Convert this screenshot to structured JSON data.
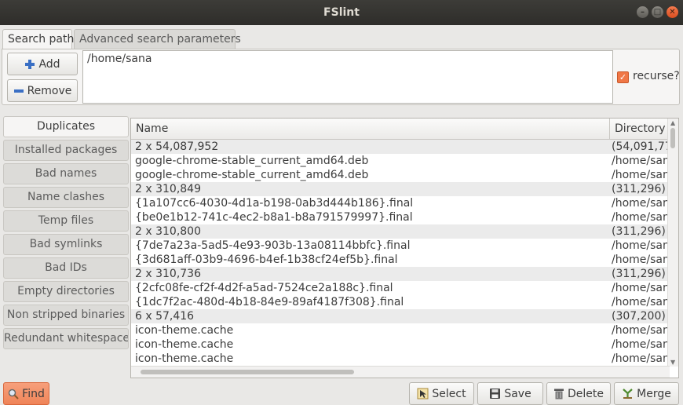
{
  "window": {
    "title": "FSlint"
  },
  "tabs": [
    {
      "label": "Search path"
    },
    {
      "label": "Advanced search parameters"
    }
  ],
  "path_panel": {
    "add_label": "Add",
    "remove_label": "Remove",
    "paths": [
      "/home/sana"
    ],
    "recurse_label": "recurse?",
    "recurse_checked": true
  },
  "sidebar": {
    "items": [
      {
        "label": "Duplicates"
      },
      {
        "label": "Installed packages"
      },
      {
        "label": "Bad names"
      },
      {
        "label": "Name clashes"
      },
      {
        "label": "Temp files"
      },
      {
        "label": "Bad symlinks"
      },
      {
        "label": "Bad IDs"
      },
      {
        "label": "Empty directories"
      },
      {
        "label": "Non stripped binaries"
      },
      {
        "label": "Redundant whitespace"
      }
    ]
  },
  "results": {
    "columns": [
      "Name",
      "Directory"
    ],
    "rows": [
      {
        "name": "2 x 54,087,952",
        "dir": "(54,091,77",
        "group": true
      },
      {
        "name": "google-chrome-stable_current_amd64.deb",
        "dir": "/home/san",
        "group": false
      },
      {
        "name": "google-chrome-stable_current_amd64.deb",
        "dir": "/home/san",
        "group": false
      },
      {
        "name": "2 x 310,849",
        "dir": "(311,296)",
        "group": true
      },
      {
        "name": "{1a107cc6-4030-4d1a-b198-0ab3d444b186}.final",
        "dir": "/home/san",
        "group": false
      },
      {
        "name": "{be0e1b12-741c-4ec2-b8a1-b8a791579997}.final",
        "dir": "/home/san",
        "group": false
      },
      {
        "name": "2 x 310,800",
        "dir": "(311,296)",
        "group": true
      },
      {
        "name": "{7de7a23a-5ad5-4e93-903b-13a08114bbfc}.final",
        "dir": "/home/san",
        "group": false
      },
      {
        "name": "{3d681aff-03b9-4696-b4ef-1b38cf24ef5b}.final",
        "dir": "/home/san",
        "group": false
      },
      {
        "name": "2 x 310,736",
        "dir": "(311,296)",
        "group": true
      },
      {
        "name": "{2cfc08fe-cf2f-4d2f-a5ad-7524ce2a188c}.final",
        "dir": "/home/san",
        "group": false
      },
      {
        "name": "{1dc7f2ac-480d-4b18-84e9-89af4187f308}.final",
        "dir": "/home/san",
        "group": false
      },
      {
        "name": "6 x 57,416",
        "dir": "(307,200)",
        "group": true
      },
      {
        "name": "icon-theme.cache",
        "dir": "/home/san",
        "group": false
      },
      {
        "name": "icon-theme.cache",
        "dir": "/home/san",
        "group": false
      },
      {
        "name": "icon-theme.cache",
        "dir": "/home/san",
        "group": false
      }
    ]
  },
  "footer": {
    "find_label": "Find",
    "select_label": "Select",
    "save_label": "Save",
    "delete_label": "Delete",
    "merge_label": "Merge"
  },
  "colors": {
    "accent": "#f07746",
    "titlebar": "#3d3c38"
  }
}
